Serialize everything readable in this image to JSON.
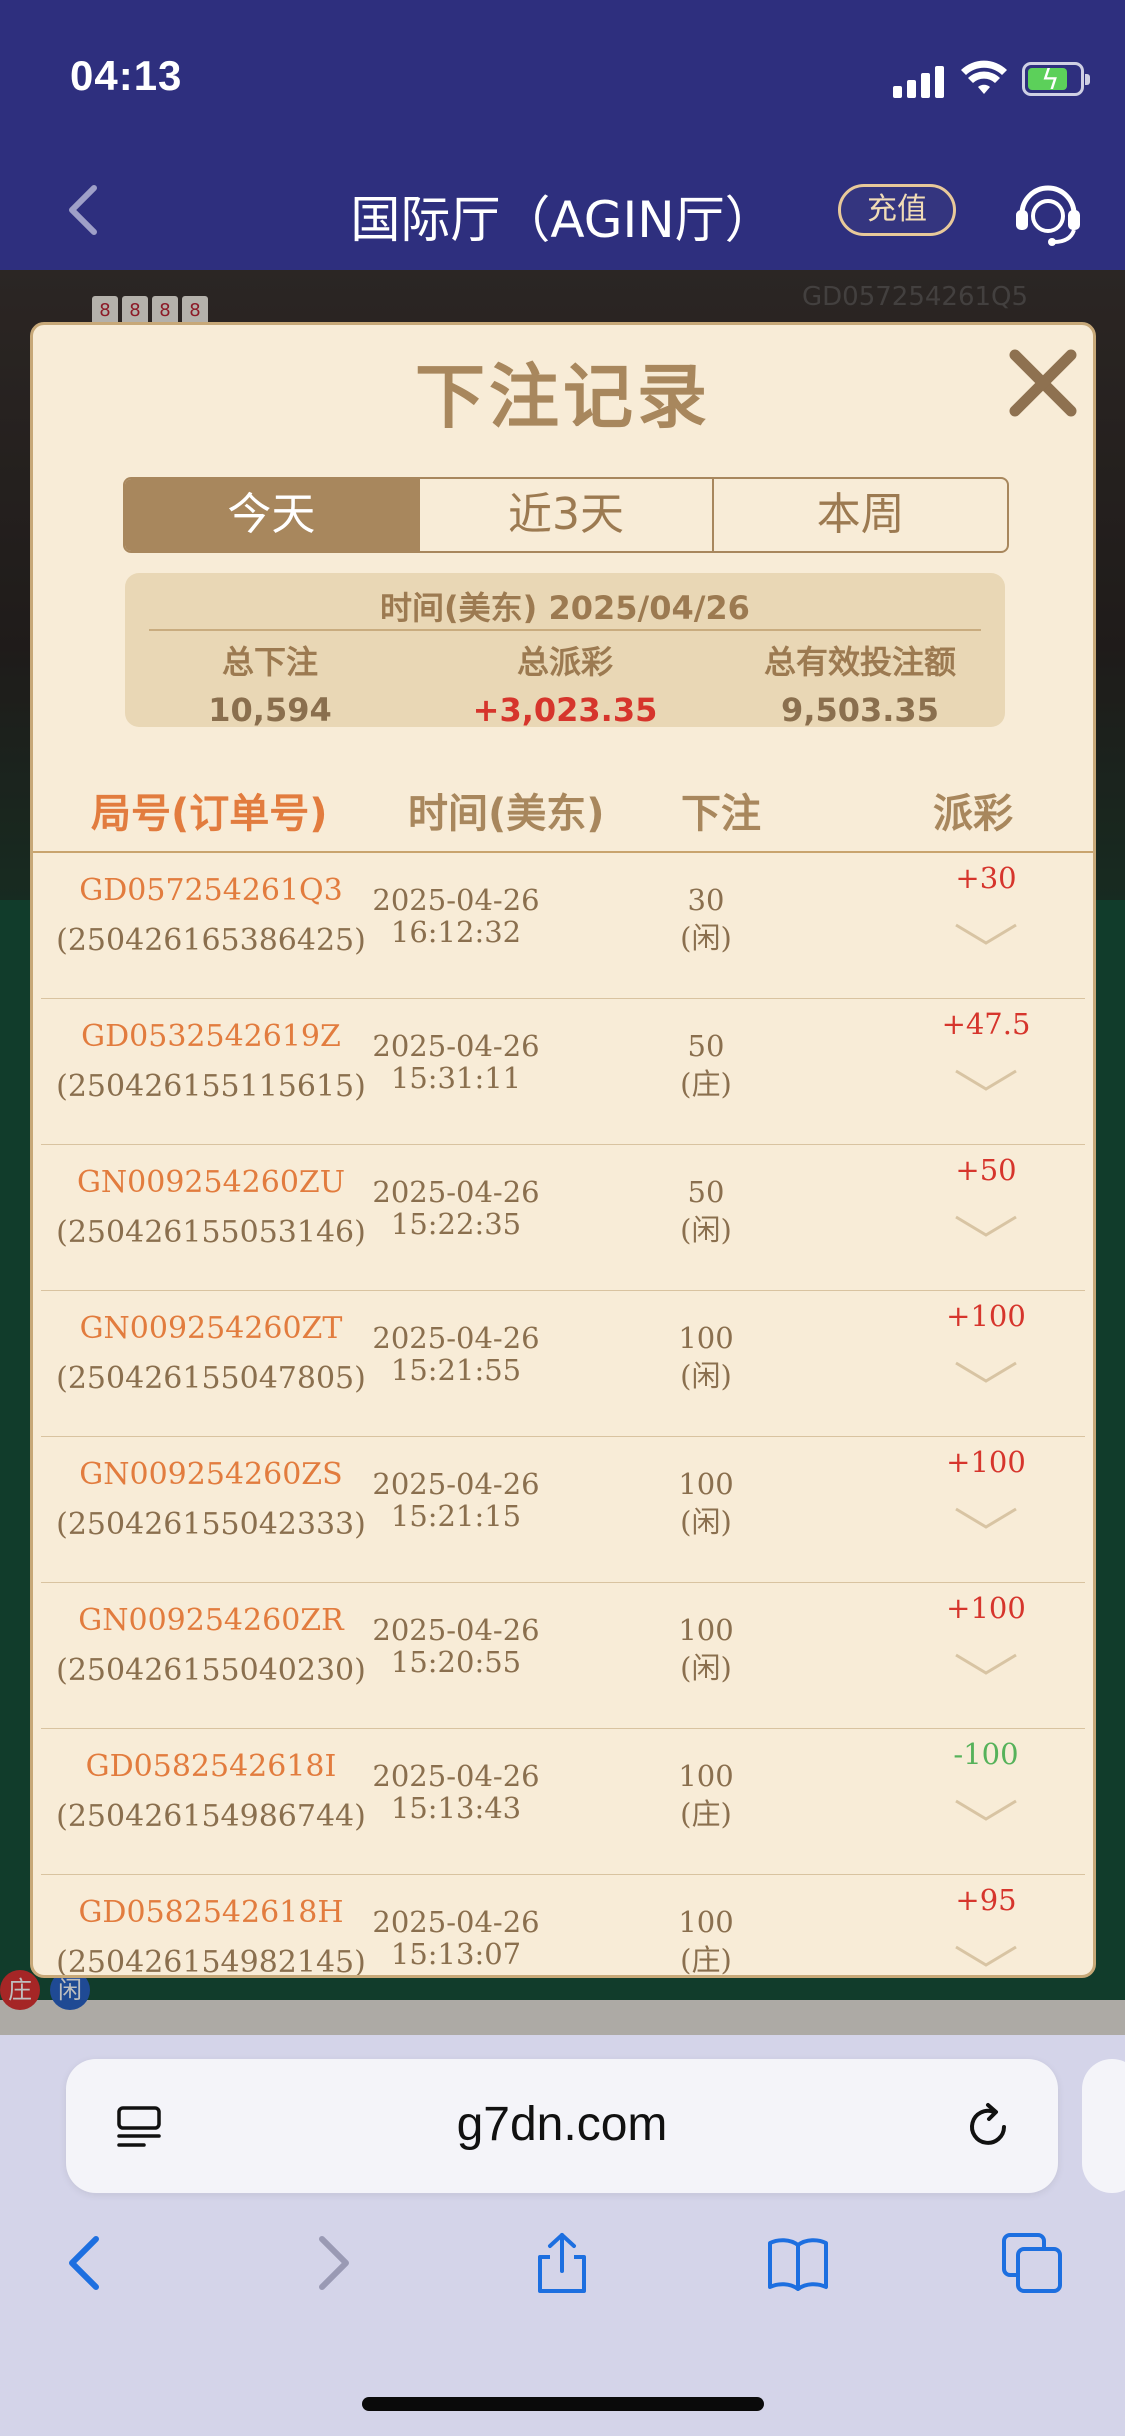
{
  "status_bar": {
    "time": "04:13"
  },
  "nav": {
    "title": "国际厅（AGIN厅）",
    "recharge_label": "充值"
  },
  "background": {
    "table_id": "GD057254261Q5"
  },
  "modal": {
    "title": "下注记录",
    "tabs": [
      {
        "label": "今天",
        "active": true
      },
      {
        "label": "近3天",
        "active": false
      },
      {
        "label": "本周",
        "active": false
      }
    ],
    "summary": {
      "date_line": "时间(美东)  2025/04/26",
      "total_bet_label": "总下注",
      "total_bet_value": "10,594",
      "total_payout_label": "总派彩",
      "total_payout_value": "+3,023.35",
      "valid_bet_label": "总有效投注额",
      "valid_bet_value": "9,503.35"
    },
    "columns": {
      "round_prefix": "局号",
      "round_suffix": "(订单号)",
      "time": "时间(美东)",
      "bet": "下注",
      "payout": "派彩"
    },
    "records": [
      {
        "round": "GD057254261Q3",
        "order": "(250426165386425)",
        "date": "2025-04-26",
        "time": "16:12:32",
        "amount": "30",
        "side": "(闲)",
        "payout": "+30"
      },
      {
        "round": "GD0532542619Z",
        "order": "(250426155115615)",
        "date": "2025-04-26",
        "time": "15:31:11",
        "amount": "50",
        "side": "(庄)",
        "payout": "+47.5"
      },
      {
        "round": "GN009254260ZU",
        "order": "(250426155053146)",
        "date": "2025-04-26",
        "time": "15:22:35",
        "amount": "50",
        "side": "(闲)",
        "payout": "+50"
      },
      {
        "round": "GN009254260ZT",
        "order": "(250426155047805)",
        "date": "2025-04-26",
        "time": "15:21:55",
        "amount": "100",
        "side": "(闲)",
        "payout": "+100"
      },
      {
        "round": "GN009254260ZS",
        "order": "(250426155042333)",
        "date": "2025-04-26",
        "time": "15:21:15",
        "amount": "100",
        "side": "(闲)",
        "payout": "+100"
      },
      {
        "round": "GN009254260ZR",
        "order": "(250426155040230)",
        "date": "2025-04-26",
        "time": "15:20:55",
        "amount": "100",
        "side": "(闲)",
        "payout": "+100"
      },
      {
        "round": "GD0582542618I",
        "order": "(250426154986744)",
        "date": "2025-04-26",
        "time": "15:13:43",
        "amount": "100",
        "side": "(庄)",
        "payout": "-100"
      },
      {
        "round": "GD0582542618H",
        "order": "(250426154982145)",
        "date": "2025-04-26",
        "time": "15:13:07",
        "amount": "100",
        "side": "(庄)",
        "payout": "+95"
      }
    ]
  },
  "browser": {
    "url": "g7dn.com"
  },
  "colors": {
    "accent_gold": "#a8875d",
    "win_red": "#d6352c",
    "loss_green": "#56b25a",
    "nav_bg": "#2e2f7e"
  }
}
